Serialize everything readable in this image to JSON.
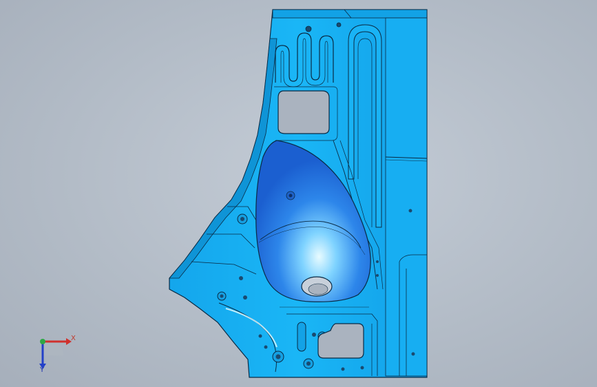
{
  "viewport": {
    "background": "#b7c0cb"
  },
  "part": {
    "color_primary": "#19aef0",
    "color_dark": "#0e8fd0",
    "color_bulge": "#2f7fe8",
    "outline": "#0a2a44"
  },
  "triad": {
    "x_label": "X",
    "y_label": "Y",
    "x_color": "#d0312d",
    "y_color": "#2340c8",
    "origin_color": "#2fa844"
  }
}
